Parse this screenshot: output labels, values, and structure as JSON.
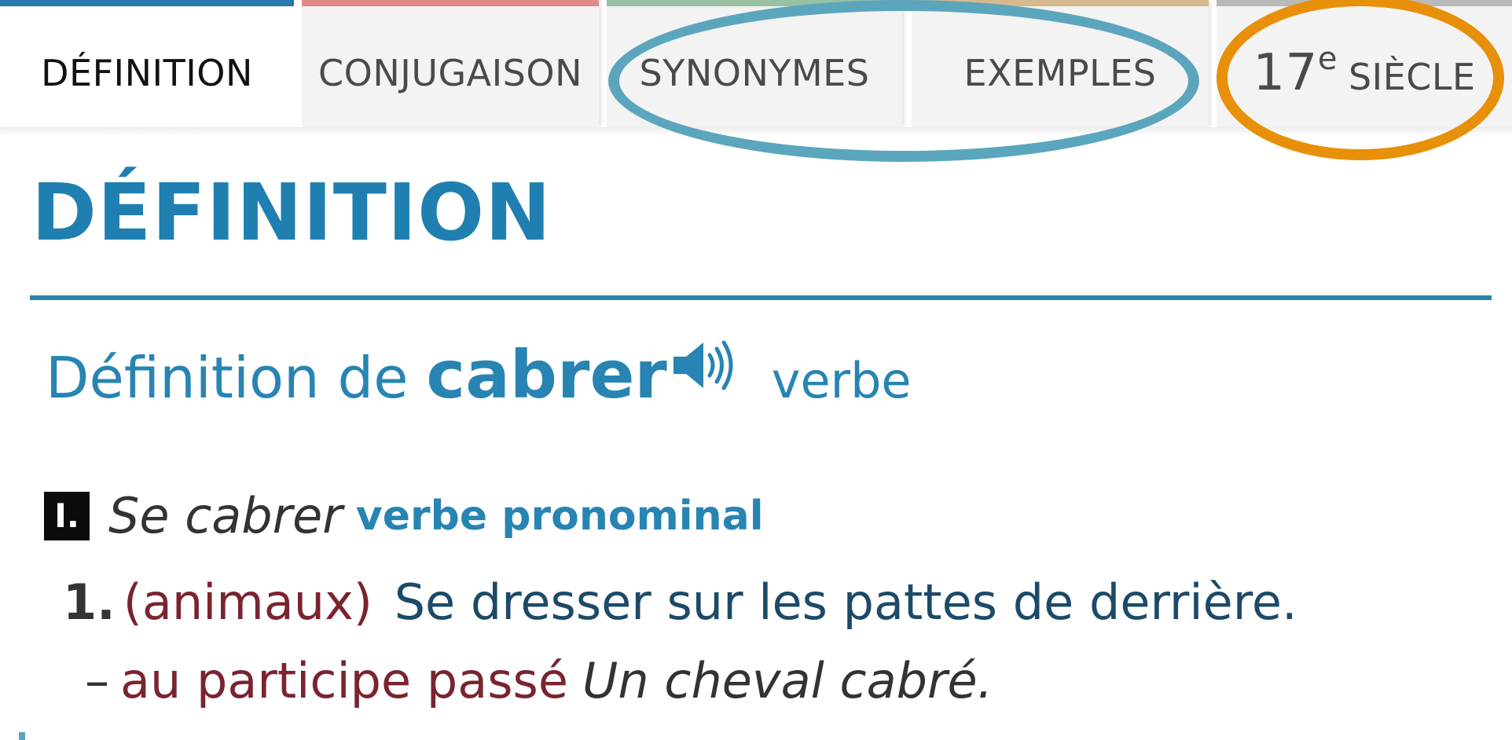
{
  "tabs": [
    {
      "label": "DÉFINITION",
      "color": "#2878ad",
      "active": true
    },
    {
      "label": "CONJUGAISON",
      "color": "#e08a8a",
      "active": false
    },
    {
      "label": "SYNONYMES",
      "color": "#98c0a3",
      "active": false
    },
    {
      "label": "EXEMPLES",
      "color": "#d6b98e",
      "active": false
    },
    {
      "number": "17",
      "superscript": "e",
      "word": "SIÈCLE",
      "color": "#b9b9b9",
      "active": false
    }
  ],
  "section": {
    "title": "DÉFINITION"
  },
  "entry": {
    "heading_prefix": "Définition de",
    "word": "cabrer",
    "part_of_speech": "verbe",
    "audio_icon": "speaker-icon",
    "sense_roman": "I.",
    "pronominal_form": "Se cabrer",
    "pronominal_type": "verbe pronominal",
    "senses": [
      {
        "number": "1.",
        "domain": "(animaux)",
        "definition": "Se dresser sur les pattes de derrière.",
        "sub_dash": "–",
        "sub_usage": "au participe passé",
        "sub_example": "Un cheval cabré."
      }
    ]
  },
  "annotations": [
    {
      "color": "#5ba6bd",
      "covers": "SYNONYMES, EXEMPLES"
    },
    {
      "color": "#e8900a",
      "covers": "17e SIÈCLE"
    }
  ]
}
